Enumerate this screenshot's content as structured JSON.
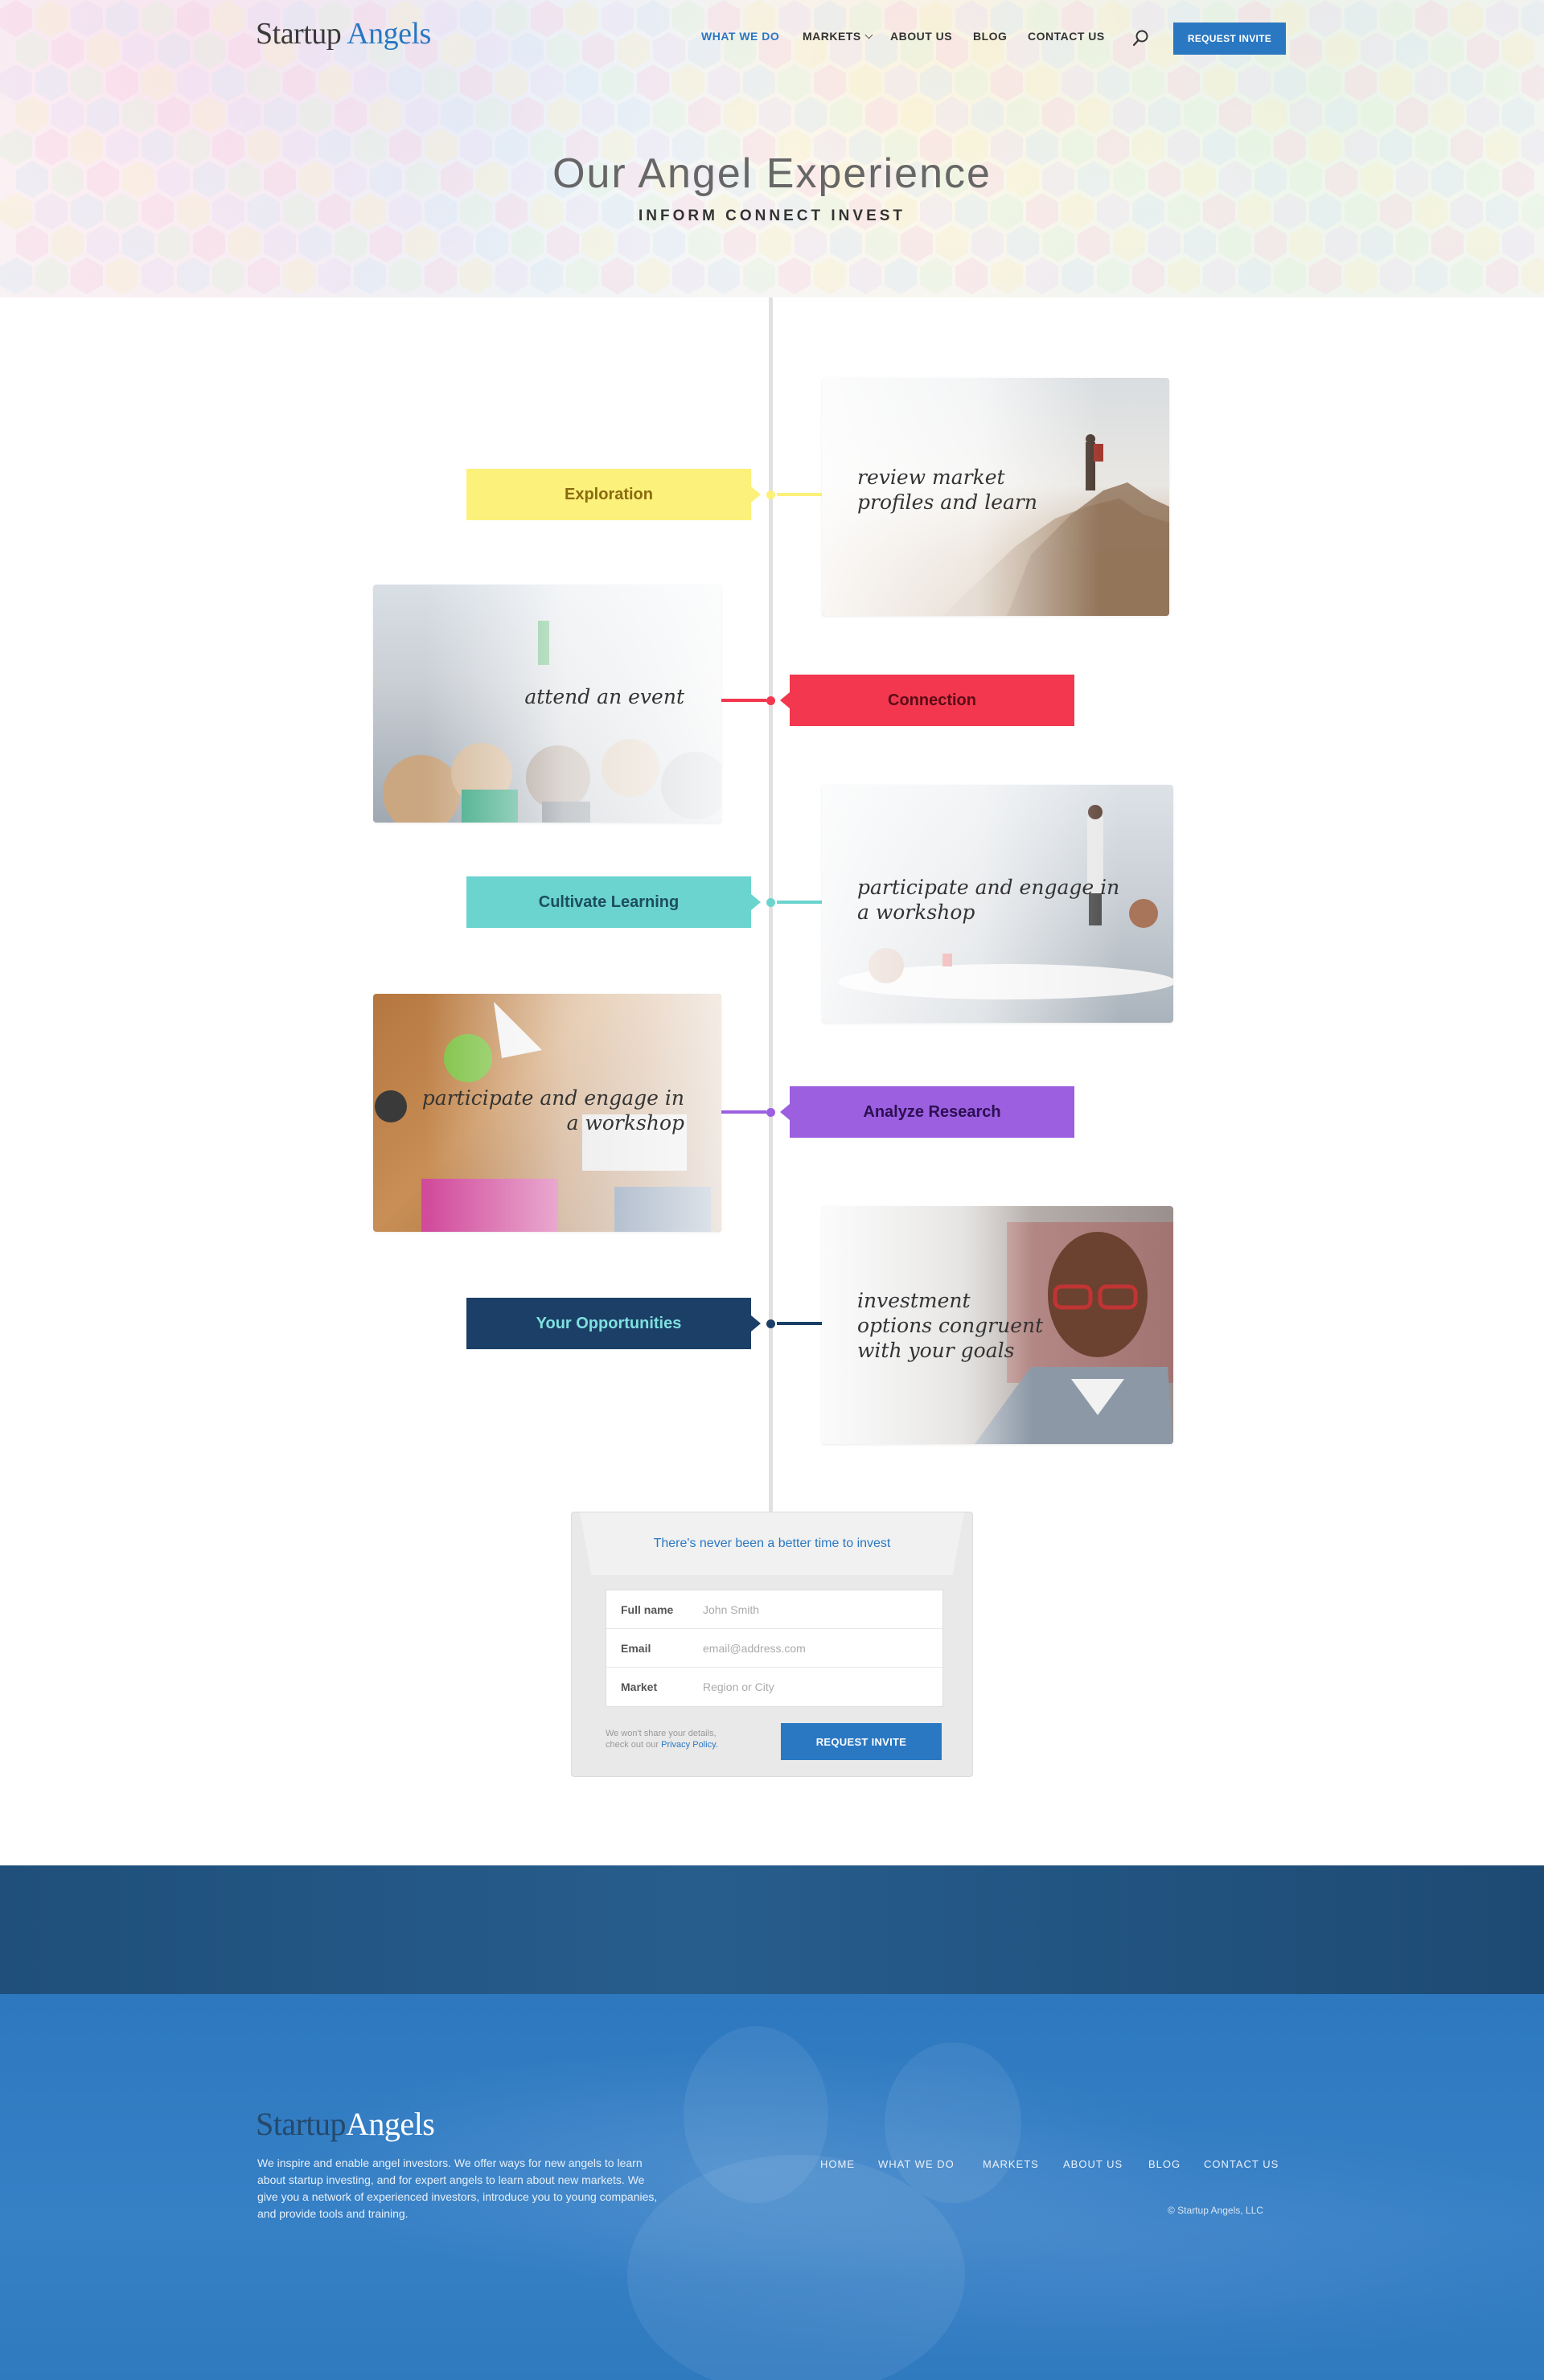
{
  "header": {
    "logo_primary": "Startup",
    "logo_accent": "Angels",
    "nav": [
      {
        "label": "WHAT WE DO",
        "active": true
      },
      {
        "label": "MARKETS",
        "has_dropdown": true
      },
      {
        "label": "ABOUT US"
      },
      {
        "label": "BLOG"
      },
      {
        "label": "CONTACT US"
      }
    ],
    "search_icon": "search-icon",
    "cta_label": "REQUEST INVITE"
  },
  "hero": {
    "title": "Our Angel Experience",
    "subtitle": "INFORM  CONNECT  INVEST"
  },
  "timeline": {
    "stages": [
      {
        "label": "Exploration",
        "color": "#fcf17a",
        "text_color": "#8a6a10",
        "caption": "review market profiles and learn"
      },
      {
        "label": "Connection",
        "color": "#f2374f",
        "text_color": "#5a0d16",
        "caption": "attend an event"
      },
      {
        "label": "Cultivate Learning",
        "color": "#6bd4cf",
        "text_color": "#1c4e5e",
        "caption": "participate and engage in a workshop"
      },
      {
        "label": "Analyze Research",
        "color": "#9b5fe0",
        "text_color": "#2d0f52",
        "caption": "participate and engage in a workshop"
      },
      {
        "label": "Your Opportunities",
        "color": "#1b3f66",
        "text_color": "#7fe0e0",
        "caption": "investment options congruent with your goals"
      }
    ]
  },
  "form": {
    "heading": "There's never been a better time to invest",
    "fields": [
      {
        "label": "Full name",
        "placeholder": "John Smith"
      },
      {
        "label": "Email",
        "placeholder": "email@address.com"
      },
      {
        "label": "Market",
        "placeholder": "Region or City"
      }
    ],
    "note_line1": "We won't share your details,",
    "note_line2": "check out our",
    "note_link": "Privacy Policy.",
    "submit_label": "REQUEST INVITE"
  },
  "footer": {
    "logo_primary": "Startup",
    "logo_accent": "Angels",
    "description": "We inspire and enable angel investors. We offer ways for new angels to learn about startup investing, and for expert angels to learn about new markets. We give you a network of experienced investors, introduce you to young companies, and provide tools and training.",
    "nav": [
      "HOME",
      "WHAT WE DO",
      "MARKETS",
      "ABOUT US",
      "BLOG",
      "CONTACT US"
    ],
    "copyright": "© Startup Angels, LLC"
  },
  "colors": {
    "brand_blue": "#2a78c2",
    "footer_dark": "#1f4f7a",
    "footer_blue": "#2f79bf"
  }
}
